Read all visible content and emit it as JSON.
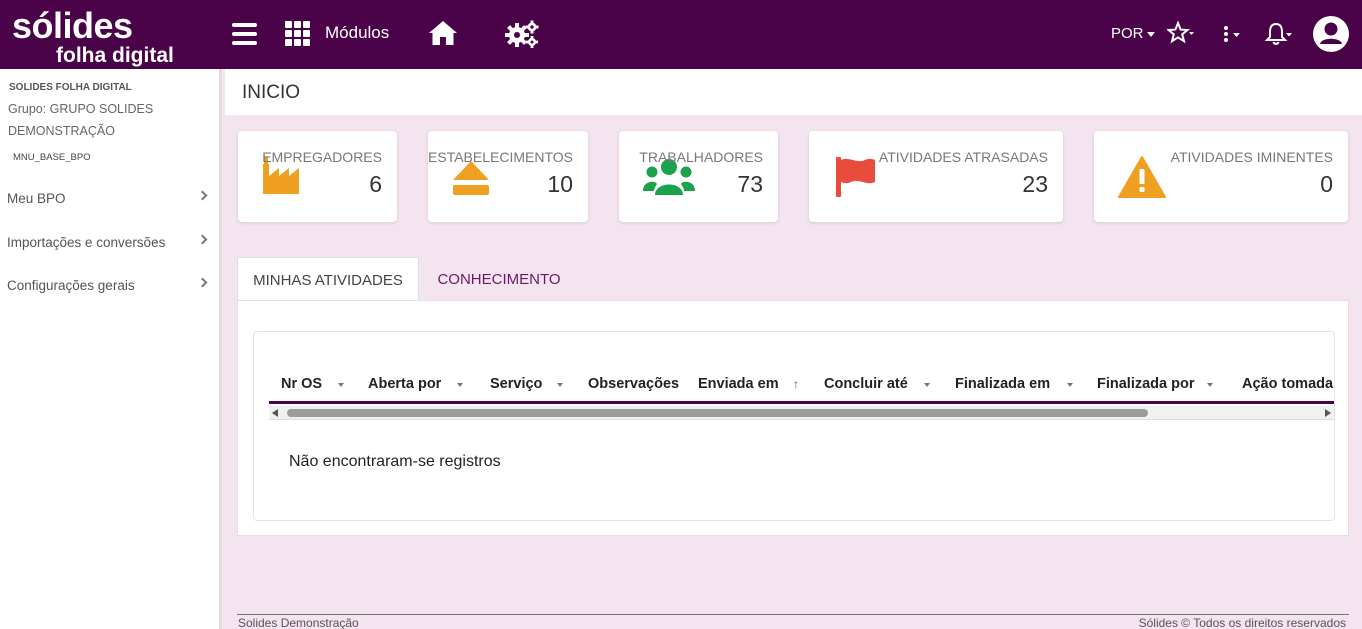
{
  "header": {
    "logo_line1": "sólides",
    "logo_line2": "folha digital",
    "modules_label": "Módulos",
    "language": "POR",
    "icons": [
      "menu-icon",
      "grid-icon",
      "home-icon",
      "gears-icon",
      "star-icon",
      "kebab-icon",
      "bell-icon",
      "user-icon"
    ],
    "bg_color": "#4a0249"
  },
  "sidebar": {
    "company": "SOLIDES FOLHA DIGITAL",
    "group": "Grupo: GRUPO SOLIDES DEMONSTRAÇÃO",
    "code": "MNU_BASE_BPO",
    "items": [
      {
        "label": "Meu BPO"
      },
      {
        "label": "Importações e conversões"
      },
      {
        "label": "Configurações gerais"
      }
    ]
  },
  "page": {
    "title": "INICIO"
  },
  "cards": [
    {
      "label": "EMPREGADORES",
      "value": "6",
      "icon": "factory-icon",
      "color": "#f0a020"
    },
    {
      "label": "ESTABELECIMENTOS",
      "value": "10",
      "icon": "eject-icon",
      "color": "#f0a020"
    },
    {
      "label": "TRABALHADORES",
      "value": "73",
      "icon": "users-icon",
      "color": "#1aa34a"
    },
    {
      "label": "ATIVIDADES ATRASADAS",
      "value": "23",
      "icon": "flag-icon",
      "color": "#e74c3c"
    },
    {
      "label": "ATIVIDADES IMINENTES",
      "value": "0",
      "icon": "warning-icon",
      "color": "#f0a020"
    }
  ],
  "tabs": [
    {
      "label": "MINHAS ATIVIDADES",
      "active": true
    },
    {
      "label": "CONHECIMENTO",
      "active": false
    }
  ],
  "table": {
    "columns": [
      "Nr OS",
      "Aberta por",
      "Serviço",
      "Observações",
      "Enviada em",
      "Concluir até",
      "Finalizada em",
      "Finalizada por",
      "Ação tomada"
    ],
    "empty_message": "Não encontraram-se registros"
  },
  "footer": {
    "left": "Solides Demonstração",
    "right": "Sólides © Todos os direitos reservados"
  }
}
